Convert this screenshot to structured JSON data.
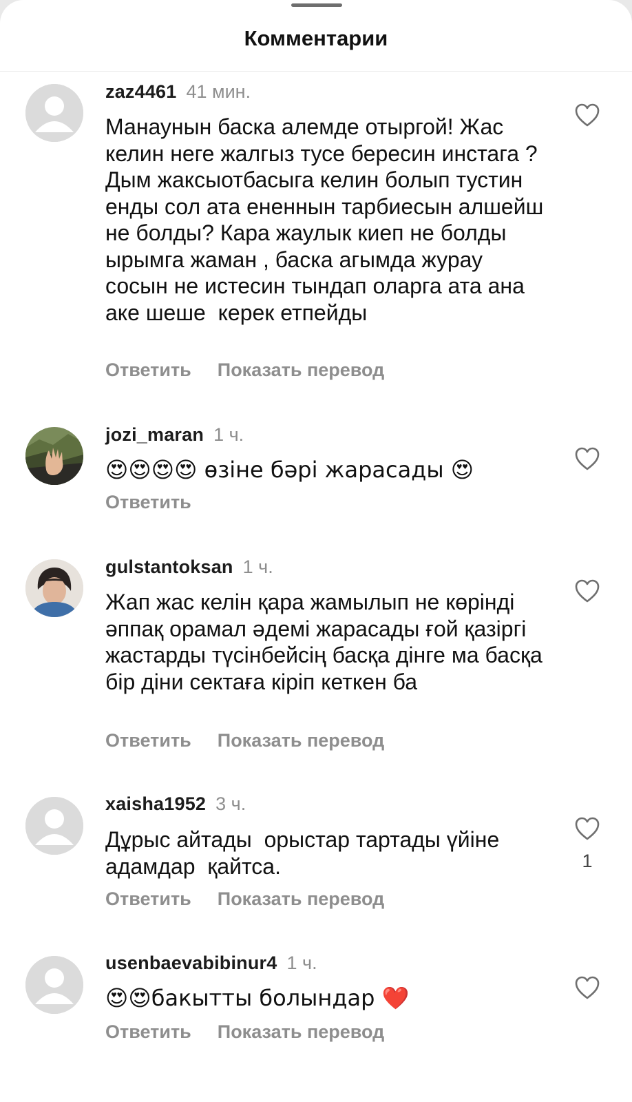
{
  "header": {
    "title": "Комментарии"
  },
  "comments": [
    {
      "username": "zaz4461",
      "time": "41 мин.",
      "avatar": "default-avatar",
      "text": "Манаунын баска алемде отыргой! Жас келин неге жалгыз тусе бересин инстага ? Дым жаксыотбасыга келин болып тустин енды сол ата ененнын тарбиесын алшейш не болды? Кара жаулык киеп не болды ырымга жаман , баска агымда журау сосын не истесин тындап оларга ата ана аке шеше  керек етпейды",
      "reply_label": "Ответить",
      "translate_label": "Показать перевод",
      "likes": ""
    },
    {
      "username": "jozi_maran",
      "time": "1 ч.",
      "avatar": "photo-hand-mountains",
      "text": "😍😍😍😍 өзіне бәрі жарасады 😍",
      "reply_label": "Ответить",
      "likes": ""
    },
    {
      "username": "gulstantoksan",
      "time": "1 ч.",
      "avatar": "photo-woman-portrait",
      "text": "Жап жас келін қара жамылып не көрінді әппақ орамал әдемі жарасады ғой қазіргі жастарды түсінбейсің басқа дінге ма басқа бір діни сектаға кіріп кеткен ба",
      "reply_label": "Ответить",
      "translate_label": "Показать перевод",
      "likes": ""
    },
    {
      "username": "xaisha1952",
      "time": "3 ч.",
      "avatar": "default-avatar",
      "text": "Дұрыс айтады  орыстар тартады үйіне адамдар  қайтса.",
      "reply_label": "Ответить",
      "translate_label": "Показать перевод",
      "likes": "1"
    },
    {
      "username": "usenbaevabibinur4",
      "time": "1 ч.",
      "avatar": "default-avatar",
      "text": "😍😍бакытты болындар ❤️",
      "reply_label": "Ответить",
      "translate_label": "Показать перевод",
      "likes": ""
    }
  ],
  "icons": {
    "like": "heart-outline-icon",
    "default_avatar": "person-silhouette-icon"
  },
  "colors": {
    "secondary_text": "#8e8e8e",
    "primary_text": "#111111",
    "avatar_bg": "#d9d9d9",
    "heart_red": "#e0245e"
  }
}
